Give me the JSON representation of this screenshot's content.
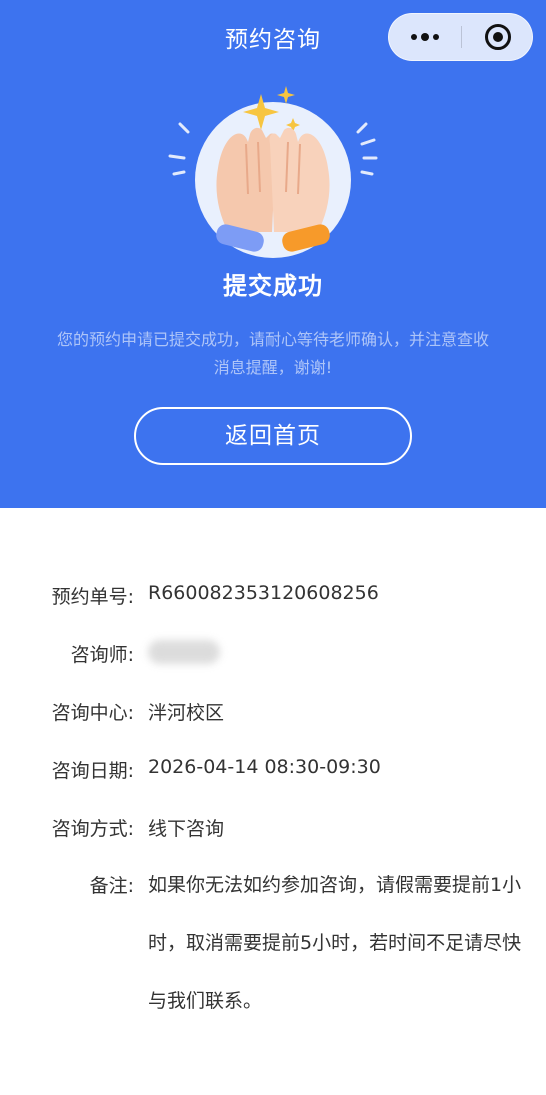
{
  "nav": {
    "title": "预约咨询"
  },
  "success": {
    "title": "提交成功",
    "message": "您的预约申请已提交成功，请耐心等待老师确认，并注意查收消息提醒，谢谢!",
    "button": "返回首页"
  },
  "details": {
    "order_no": {
      "label": "预约单号:",
      "value": "R660082353120608256"
    },
    "counselor": {
      "label": "咨询师:",
      "value": ""
    },
    "center": {
      "label": "咨询中心:",
      "value": "泮河校区"
    },
    "date": {
      "label": "咨询日期:",
      "value": "2026-04-14 08:30-09:30"
    },
    "method": {
      "label": "咨询方式:",
      "value": "线下咨询"
    },
    "note": {
      "label": "备注:",
      "value": "如果你无法如约参加咨询，请假需要提前1小时，取消需要提前5小时，若时间不足请尽快与我们联系。"
    }
  },
  "icons": {
    "more": "more-dots-icon",
    "close": "capsule-close-icon",
    "illustration": "high-five-hands-illustration"
  },
  "colors": {
    "brand_blue": "#3d73ef",
    "text": "#333333"
  }
}
